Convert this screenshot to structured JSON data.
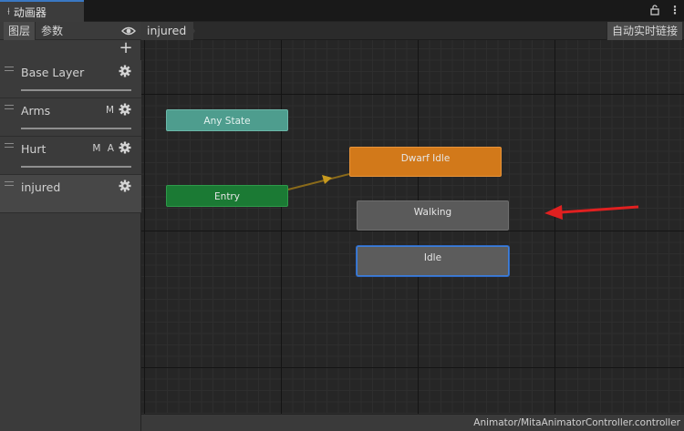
{
  "window": {
    "tab_title": "动画器",
    "tab_icon": "animator-icon",
    "lock_glyph": "🔓",
    "menu_glyph": "⋮"
  },
  "left_panel": {
    "tabs": [
      {
        "label": "图层",
        "active": true
      },
      {
        "label": "参数",
        "active": false
      }
    ],
    "eye_icon": "eye-icon",
    "add_glyph": "+",
    "layers": [
      {
        "name": "Base Layer",
        "flags": "",
        "selected": false
      },
      {
        "name": "Arms",
        "flags": "M",
        "selected": false
      },
      {
        "name": "Hurt",
        "flags": "M A",
        "selected": false
      },
      {
        "name": "injured",
        "flags": "",
        "selected": true
      }
    ]
  },
  "main": {
    "breadcrumb": "injured",
    "auto_live_link_label": "自动实时链接",
    "states": {
      "any_state": "Any State",
      "entry": "Entry",
      "dwarf_idle": "Dwarf Idle",
      "walking": "Walking",
      "idle": "Idle"
    },
    "status_path": "Animator/MitaAnimatorController.controller"
  },
  "colors": {
    "any_state": "#4e9d8e",
    "entry": "#1b7a34",
    "default_state": "#d2791a",
    "state": "#5a5a5a",
    "selected_outline": "#3f7fd8",
    "annotation_arrow": "#e02020"
  }
}
